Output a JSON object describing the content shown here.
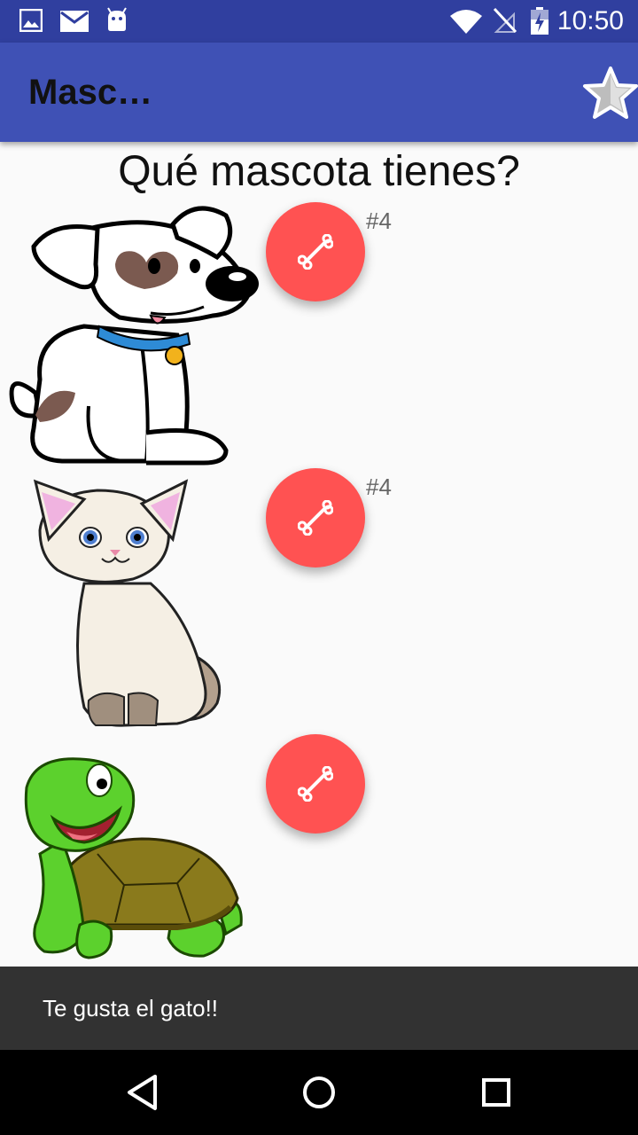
{
  "status_bar": {
    "time": "10:50",
    "icons": [
      "image-icon",
      "mail-icon",
      "android-icon",
      "wifi-icon",
      "no-signal-icon",
      "battery-icon"
    ]
  },
  "app_bar": {
    "title": "Masc…",
    "action_icon": "star-icon"
  },
  "heading": "Qué mascota tienes?",
  "pets": [
    {
      "animal": "dog",
      "button_icon": "bone-icon",
      "count": "#4"
    },
    {
      "animal": "cat",
      "button_icon": "bone-icon",
      "count": "#4"
    },
    {
      "animal": "turtle",
      "button_icon": "bone-icon",
      "count": ""
    }
  ],
  "snackbar": {
    "message": "Te gusta el gato!!"
  },
  "nav_bar": {
    "icons": [
      "back-icon",
      "home-icon",
      "recents-icon"
    ]
  },
  "colors": {
    "status_bar": "#303f9f",
    "app_bar": "#3f51b5",
    "fab": "#ff5252",
    "snackbar": "#323232",
    "nav_bar": "#000000"
  }
}
